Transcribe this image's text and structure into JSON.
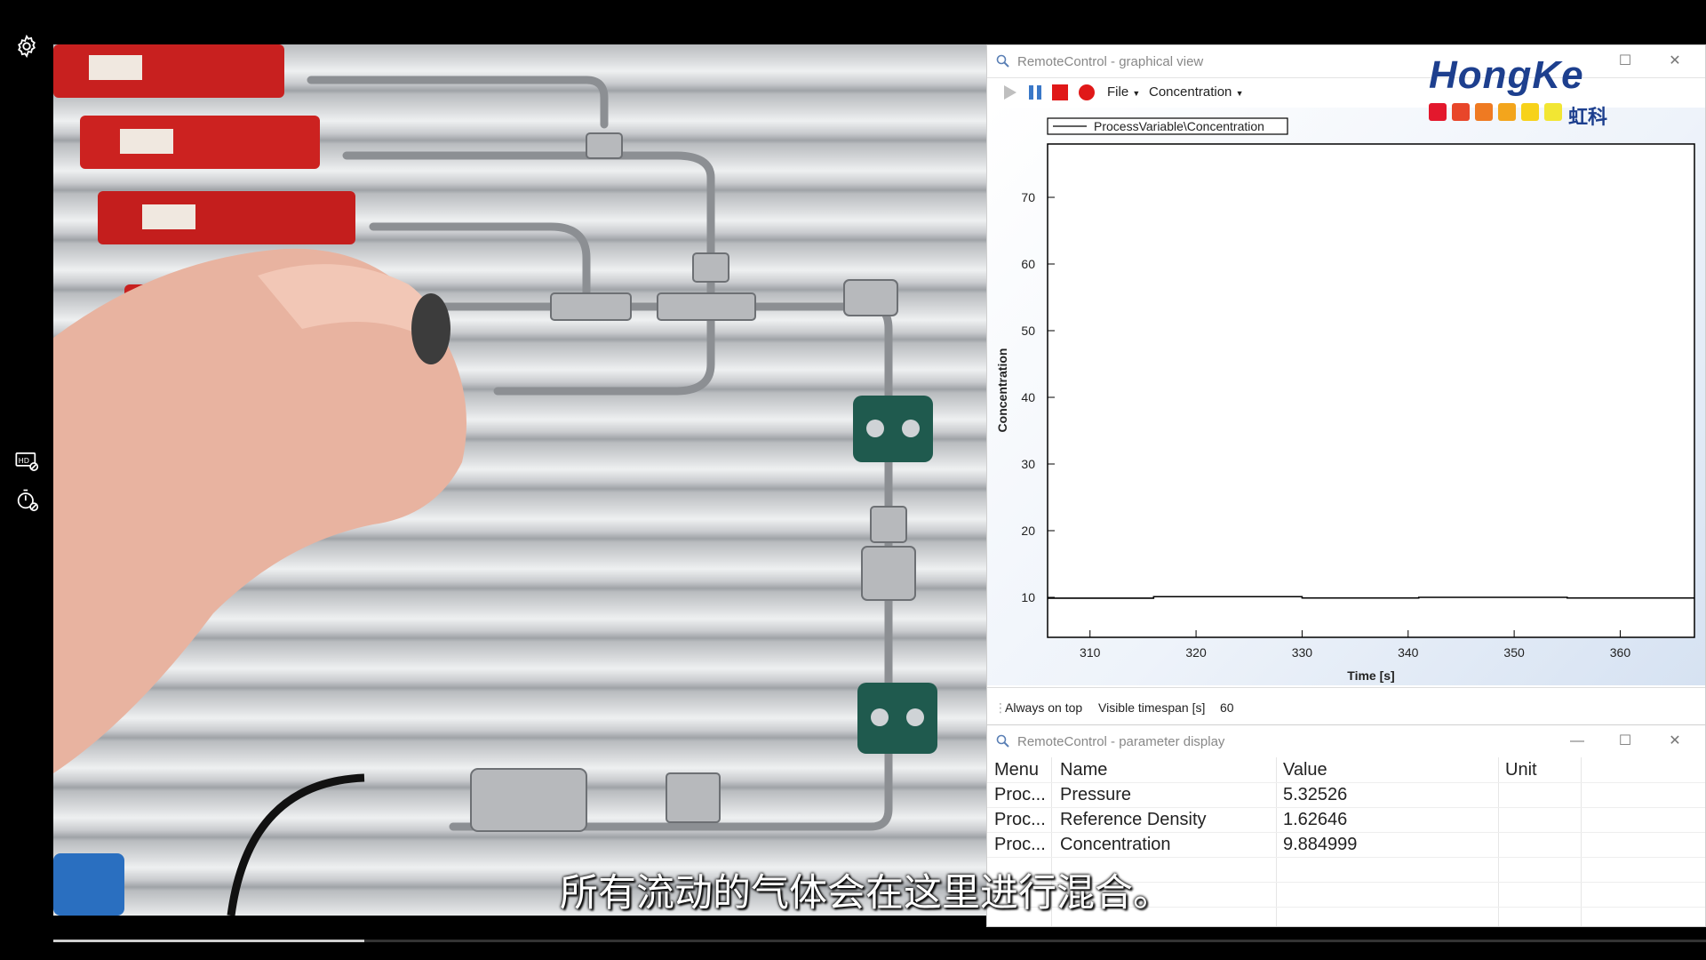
{
  "left_rail": {
    "icons": [
      "gear-icon",
      "hd-off-icon",
      "timer-off-icon"
    ]
  },
  "graph_window": {
    "title": "RemoteControl - graphical view",
    "toolbar": {
      "icons": [
        "play-icon",
        "pause-icon",
        "stop-icon",
        "record-icon"
      ],
      "file_menu": "File",
      "concentration_menu": "Concentration"
    },
    "statusbar": {
      "always_on_top": "Always on top",
      "visible_timespan_label": "Visible timespan [s]",
      "visible_timespan_value": "60"
    }
  },
  "chart_data": {
    "type": "line",
    "legend": "ProcessVariable\\Concentration",
    "xlabel": "Time [s]",
    "ylabel": "Concentration",
    "xlim": [
      306,
      367
    ],
    "ylim": [
      4,
      78
    ],
    "x_ticks": [
      310,
      320,
      330,
      340,
      350,
      360
    ],
    "y_ticks": [
      10,
      20,
      30,
      40,
      50,
      60,
      70
    ],
    "series": [
      {
        "x": [
          306,
          316,
          316,
          330,
          330,
          341,
          341,
          355,
          355,
          367
        ],
        "y": [
          9.88,
          9.88,
          10.1,
          10.1,
          9.9,
          9.9,
          10.0,
          10.0,
          9.9,
          9.9
        ]
      }
    ],
    "line_color": "#000000"
  },
  "param_window": {
    "title": "RemoteControl - parameter display",
    "headers": [
      "Menu",
      "Name",
      "Value",
      "Unit"
    ],
    "rows": [
      [
        "Proc...",
        "Pressure",
        "5.32526",
        ""
      ],
      [
        "Proc...",
        "Reference Density",
        "1.62646",
        ""
      ],
      [
        "Proc...",
        "Concentration",
        "9.884999",
        ""
      ]
    ]
  },
  "logo": {
    "text": "HongKe",
    "chinese": "虹科",
    "colors": [
      "#e3182d",
      "#e8462a",
      "#ef7a22",
      "#f3a51c",
      "#f7d21a",
      "#f2e633"
    ]
  },
  "subtitle": "所有流动的气体会在这里进行混合。",
  "video_progress": 0.188
}
